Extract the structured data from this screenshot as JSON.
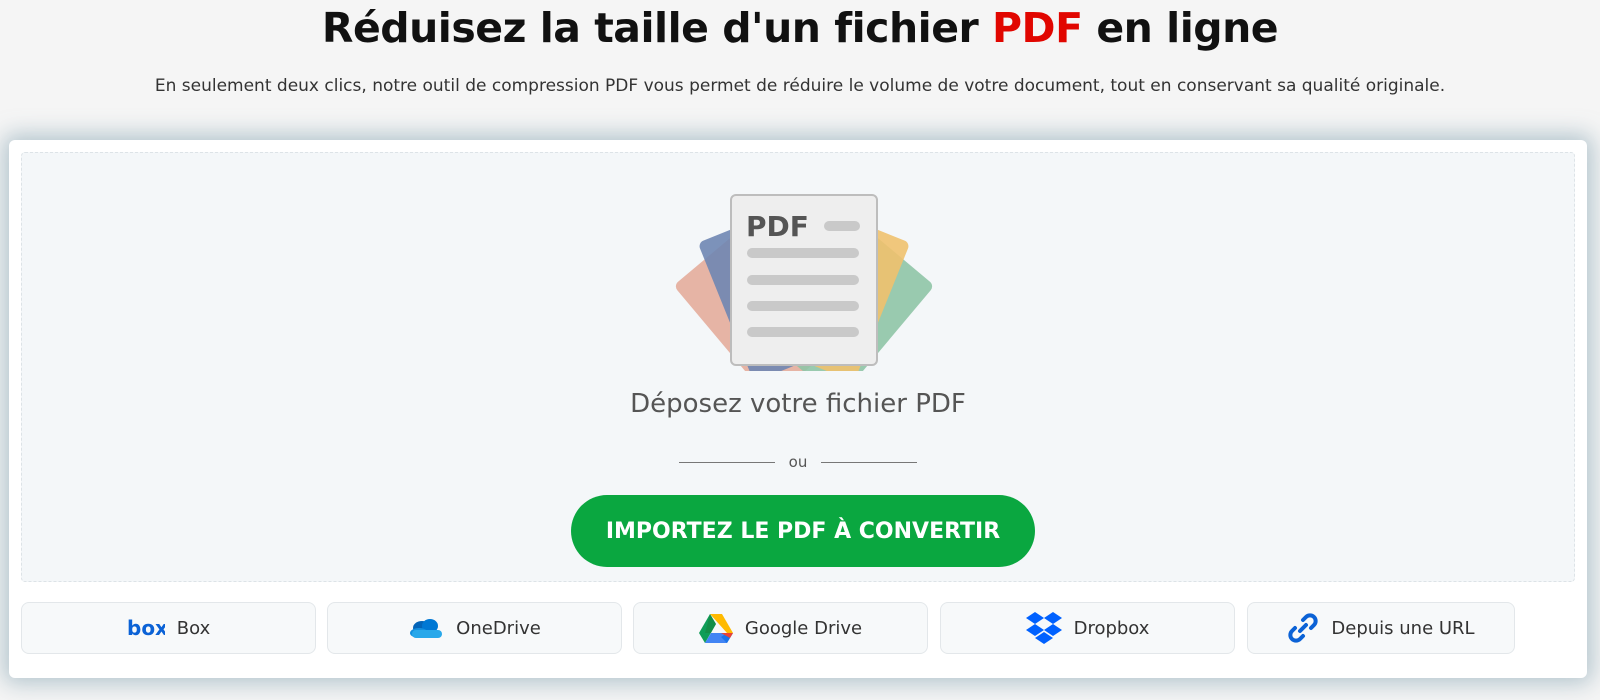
{
  "hero": {
    "title_before": "Réduisez la taille d'un fichier ",
    "title_accent": "PDF",
    "title_after": " en ligne",
    "subtitle": "En seulement deux clics, notre outil de compression PDF vous permet de réduire le volume de votre document, tout en conservant sa qualité originale.",
    "accent_color": "#e10600"
  },
  "dropzone": {
    "illustration_label": "PDF",
    "drop_label": "Déposez votre fichier PDF",
    "or_label": "ou",
    "import_button": "IMPORTEZ LE PDF À CONVERTIR",
    "button_color": "#0aa740"
  },
  "sources": [
    {
      "label": "Box",
      "icon": "box-logo-icon"
    },
    {
      "label": "OneDrive",
      "icon": "onedrive-icon"
    },
    {
      "label": "Google Drive",
      "icon": "google-drive-icon"
    },
    {
      "label": "Dropbox",
      "icon": "dropbox-icon"
    },
    {
      "label": "Depuis une URL",
      "icon": "link-icon"
    }
  ]
}
